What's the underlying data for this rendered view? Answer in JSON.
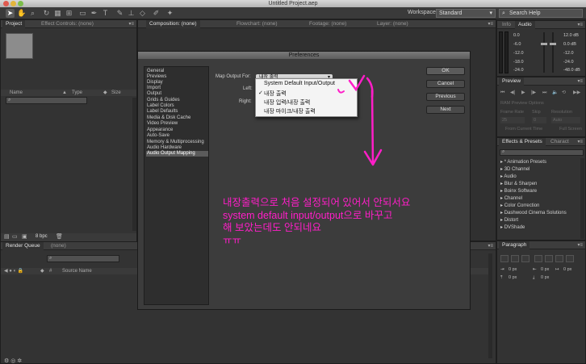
{
  "window": {
    "title": "Untitled Project.aep"
  },
  "toolbar": {
    "workspace_label": "Workspace:",
    "workspace_value": "Standard",
    "search_placeholder": "Search Help"
  },
  "project_panel": {
    "tab_project": "Project",
    "tab_effect_controls": "Effect Controls: (none)",
    "col_name": "Name",
    "col_type": "Type",
    "col_size": "Size",
    "bpc": "8 bpc"
  },
  "viewer": {
    "tab_composition": "Composition: (none)",
    "tab_flowchart": "Flowchart: (none)",
    "tab_footage": "Footage: (none)",
    "tab_layer": "Layer: (none)"
  },
  "render_queue": {
    "tab": "Render Queue",
    "tab_none": "(none)",
    "col_source": "Source Name"
  },
  "info_panel": {
    "tab_info": "Info",
    "tab_audio": "Audio",
    "left_values": [
      "0.0",
      "-6.0",
      "-12.0",
      "-18.0",
      "-24.0"
    ],
    "right_values": [
      "12.0 dB",
      "0.0 dB",
      "-12.0",
      "-24.0",
      "-48.0 dB"
    ]
  },
  "preview_panel": {
    "tab": "Preview",
    "ram_options": "RAM Preview Options",
    "col_frame_rate": "Frame Rate",
    "col_skip": "Skip",
    "col_resolution": "Resolution",
    "frame_rate": "25",
    "skip": "0",
    "resolution": "Auto",
    "from_current": "From Current Time",
    "full_screen": "Full Screen"
  },
  "effects_panel": {
    "tab": "Effects & Presets",
    "tab_character": "Charact",
    "items": [
      "* Animation Presets",
      "3D Channel",
      "Audio",
      "Blur & Sharpen",
      "Boinx Software",
      "Channel",
      "Color Correction",
      "Dashwood Cinema Solutions",
      "Distort",
      "DVShade"
    ]
  },
  "paragraph_panel": {
    "tab": "Paragraph",
    "px_values": [
      "0 px",
      "0 px",
      "0 px",
      "0 px",
      "0 px"
    ]
  },
  "dialog": {
    "title": "Preferences",
    "categories": [
      "General",
      "Previews",
      "Display",
      "Import",
      "Output",
      "Grids & Guides",
      "Label Colors",
      "Label Defaults",
      "Media & Disk Cache",
      "Video Preview",
      "Appearance",
      "Auto-Save",
      "Memory & Multiprocessing",
      "Audio Hardware",
      "Audio Output Mapping"
    ],
    "selected_category": "Audio Output Mapping",
    "map_output_label": "Map Output For:",
    "map_output_value": "내장 출력",
    "left_label": "Left:",
    "right_label": "Right:",
    "buttons": {
      "ok": "OK",
      "cancel": "Cancel",
      "previous": "Previous",
      "next": "Next"
    }
  },
  "popup": {
    "options": [
      "System Default Input/Output",
      "내장 출력",
      "내장 입력/내장 출력",
      "내장 마이크/내장 출력"
    ],
    "checked": "✓"
  },
  "annotation": {
    "lines": [
      "내장출력으로 처음 설정되어 있어서 안되서요",
      "system default input/output으로 바꾸고",
      "해 보았는데도 안되네요",
      "ㅠㅠ"
    ],
    "color": "#ff1ec8"
  },
  "colors": {
    "panel_bg": "#333333",
    "dialog_bg": "#3c3c3c",
    "annotation": "#ff1ec8"
  }
}
